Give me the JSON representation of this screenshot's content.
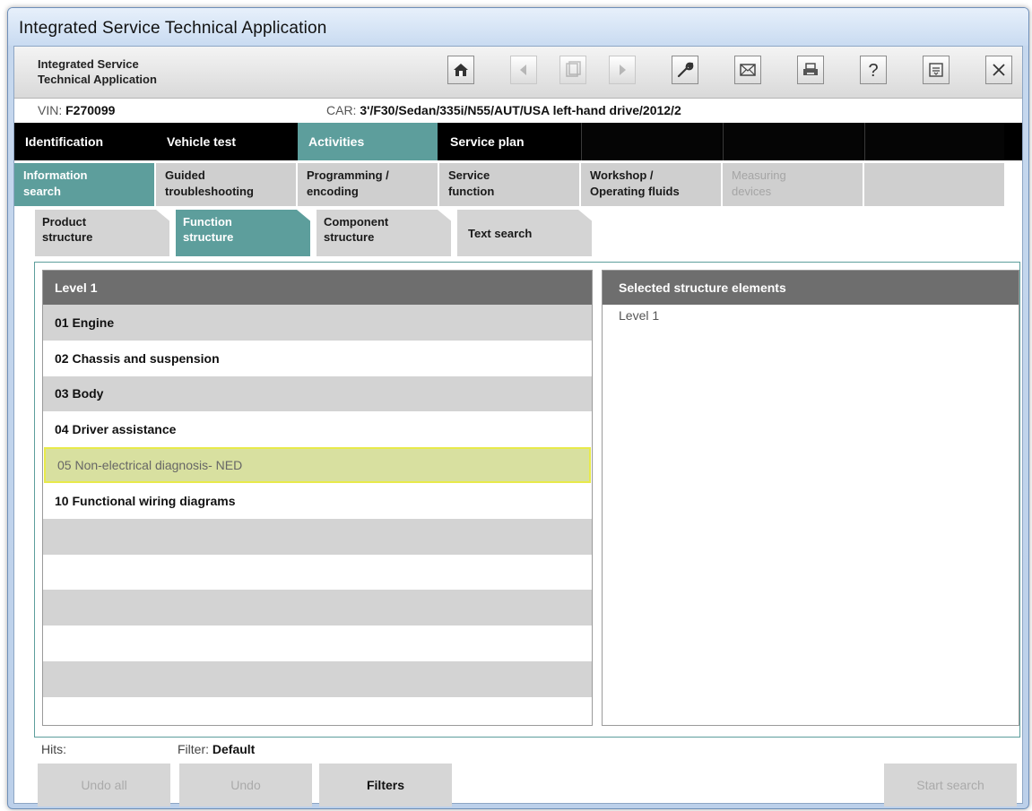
{
  "window": {
    "title": "Integrated Service Technical Application"
  },
  "header": {
    "app_name": "Integrated Service\nTechnical Application",
    "tools": [
      {
        "name": "home-icon",
        "enabled": true
      },
      {
        "name": "back-icon",
        "enabled": false
      },
      {
        "name": "history-icon",
        "enabled": false
      },
      {
        "name": "forward-icon",
        "enabled": false
      },
      {
        "name": "wrench-icon",
        "enabled": true
      },
      {
        "name": "envelope-icon",
        "enabled": true
      },
      {
        "name": "print-icon",
        "enabled": true
      },
      {
        "name": "help-icon",
        "enabled": true
      },
      {
        "name": "minimize-icon",
        "enabled": true
      },
      {
        "name": "close-icon",
        "enabled": true
      }
    ]
  },
  "vehicle": {
    "vin_label": "VIN:",
    "vin_value": "F270099",
    "car_label": "CAR:",
    "car_value": "3'/F30/Sedan/335i/N55/AUT/USA left-hand drive/2012/2"
  },
  "main_tabs": [
    {
      "label": "Identification"
    },
    {
      "label": "Vehicle test"
    },
    {
      "label": "Activities",
      "active": true
    },
    {
      "label": "Service plan"
    },
    {
      "label": ""
    },
    {
      "label": ""
    },
    {
      "label": ""
    }
  ],
  "sub_tabs": [
    {
      "label": "Information\nsearch",
      "active": true
    },
    {
      "label": "Guided\ntroubleshooting"
    },
    {
      "label": "Programming /\nencoding"
    },
    {
      "label": "Service\nfunction"
    },
    {
      "label": "Workshop /\nOperating fluids"
    },
    {
      "label": "Measuring\ndevices",
      "disabled": true
    },
    {
      "label": ""
    }
  ],
  "third_tabs": [
    {
      "label": "Product\nstructure"
    },
    {
      "label": "Function\nstructure",
      "active": true
    },
    {
      "label": "Component\nstructure"
    },
    {
      "label": "Text search"
    }
  ],
  "level_panel": {
    "header": "Level 1",
    "items": [
      "01 Engine",
      "02 Chassis and suspension",
      "03 Body",
      "04 Driver assistance",
      "05 Non-electrical diagnosis- NED",
      "10 Functional wiring diagrams",
      "",
      "",
      "",
      "",
      "",
      ""
    ],
    "selected_index": 4
  },
  "selected_panel": {
    "header": "Selected structure elements",
    "items": [
      "Level 1"
    ]
  },
  "footer": {
    "hits_label": "Hits:",
    "filter_label": "Filter:",
    "filter_value": "Default",
    "buttons": {
      "undo_all": "Undo all",
      "undo": "Undo",
      "filters": "Filters",
      "start_search": "Start search"
    }
  }
}
